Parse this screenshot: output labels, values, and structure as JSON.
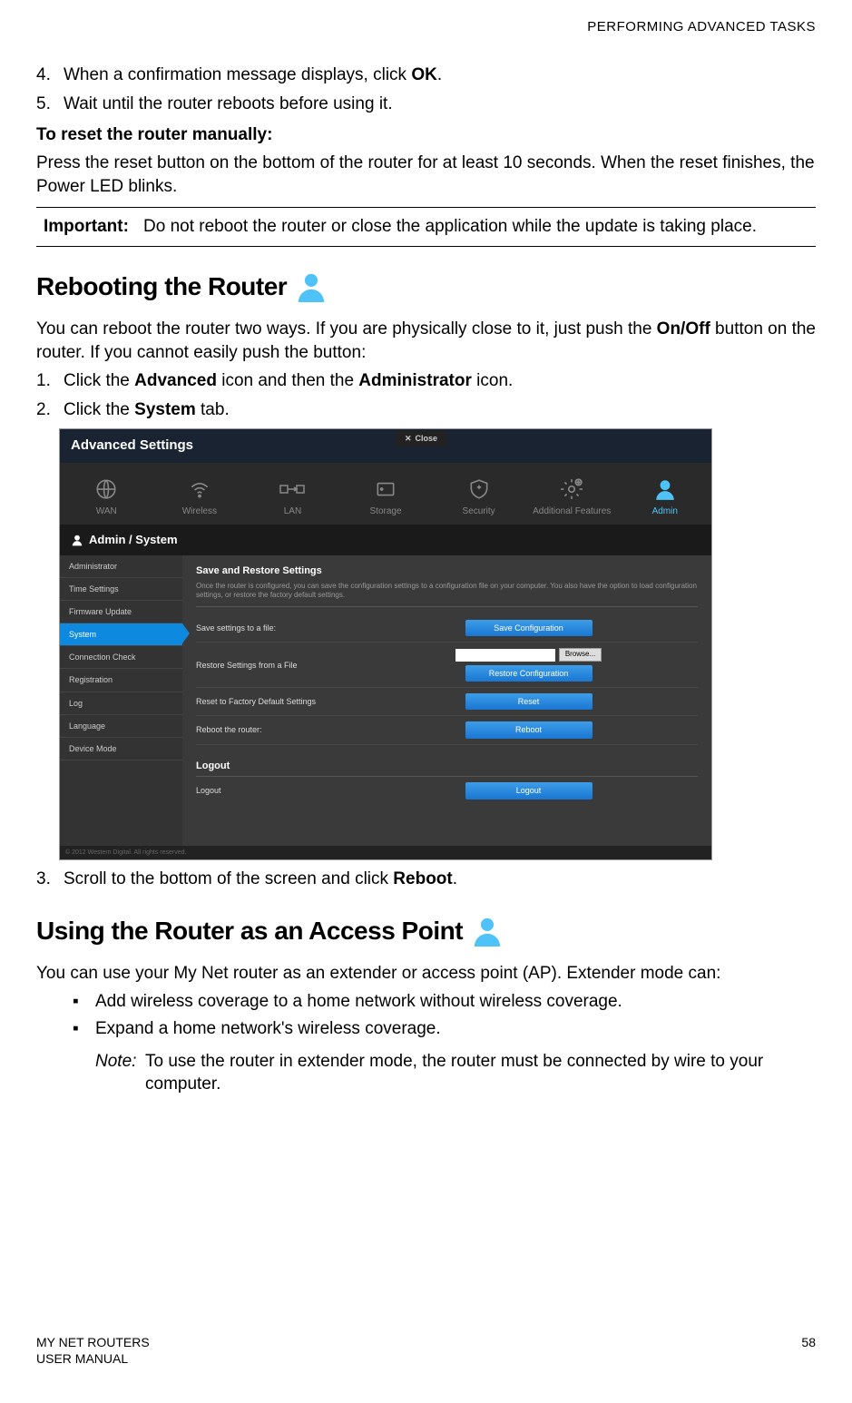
{
  "header": {
    "right": "PERFORMING ADVANCED TASKS"
  },
  "intro": {
    "step4_num": "4.",
    "step4_a": "When a confirmation message displays, click ",
    "step4_b": "OK",
    "step4_c": ".",
    "step5_num": "5.",
    "step5": "Wait until the router reboots before using it.",
    "sub": "To reset the router manually:",
    "para": "Press the reset button on the bottom of the router for at least 10 seconds. When the reset finishes, the Power LED blinks.",
    "important_label": "Important:",
    "important_text": "Do not reboot the router or close the application while the update is taking place."
  },
  "reboot": {
    "title": "Rebooting the Router",
    "para_a": "You can reboot the router two ways. If you are physically close to it, just push the ",
    "para_b": "On/Off",
    "para_c": " button on the router. If you cannot easily push the button:",
    "s1_num": "1.",
    "s1_a": "Click the ",
    "s1_b": "Advanced",
    "s1_c": " icon and then the ",
    "s1_d": "Administrator",
    "s1_e": " icon.",
    "s2_num": "2.",
    "s2_a": "Click the ",
    "s2_b": "System",
    "s2_c": " tab.",
    "s3_num": "3.",
    "s3_a": "Scroll to the bottom of the screen and click ",
    "s3_b": "Reboot",
    "s3_c": "."
  },
  "ss": {
    "title": "Advanced Settings",
    "close": "Close",
    "nav": [
      "WAN",
      "Wireless",
      "LAN",
      "Storage",
      "Security",
      "Additional Features",
      "Admin"
    ],
    "breadcrumb": "Admin / System",
    "sidebar": [
      "Administrator",
      "Time Settings",
      "Firmware Update",
      "System",
      "Connection Check",
      "Registration",
      "Log",
      "Language",
      "Device Mode"
    ],
    "section_title": "Save and Restore Settings",
    "section_desc": "Once the router is configured, you can save the configuration settings to a configuration file on your computer. You also have the option to load configuration settings, or restore the factory default settings.",
    "rows": {
      "save_label": "Save settings to a file:",
      "save_btn": "Save Configuration",
      "restore_label": "Restore Settings from a File",
      "browse": "Browse...",
      "restore_btn": "Restore Configuration",
      "reset_label": "Reset to Factory Default Settings",
      "reset_btn": "Reset",
      "reboot_label": "Reboot the router:",
      "reboot_btn": "Reboot"
    },
    "logout_hdr": "Logout",
    "logout_label": "Logout",
    "logout_btn": "Logout",
    "footer": "© 2012 Western Digital. All rights reserved."
  },
  "ap": {
    "title": "Using the Router as an Access Point",
    "para": "You can use your My Net router as an extender or access point (AP). Extender mode can:",
    "b1": "Add wireless coverage to a home network without wireless coverage.",
    "b2": "Expand a home network's wireless coverage.",
    "note_label": "Note:",
    "note_text": "To use the router in extender mode, the router must be connected by wire to your computer."
  },
  "footer": {
    "l1": "MY NET ROUTERS",
    "l2": "USER MANUAL",
    "page": "58"
  }
}
